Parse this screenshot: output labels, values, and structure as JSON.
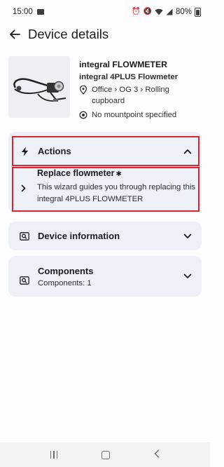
{
  "status": {
    "time": "15:00",
    "battery": "80%"
  },
  "app_bar": {
    "title": "Device details"
  },
  "device": {
    "name": "integral FLOWMETER",
    "model": "integral 4PLUS Flowmeter",
    "location": "Office › OG 3 › Rolling cupboard",
    "mountpoint": "No mountpoint specified"
  },
  "actions": {
    "label": "Actions",
    "wizard_title": "Replace flowmeter",
    "wizard_desc": "This wizard guides you through replacing this integral 4PLUS FLOWMETER"
  },
  "device_info": {
    "label": "Device information"
  },
  "components": {
    "label": "Components",
    "count": "Components: 1"
  },
  "colors": {
    "highlight": "#d7262f",
    "panel": "#eef0f7",
    "thumb_bg": "#eeeef5"
  }
}
